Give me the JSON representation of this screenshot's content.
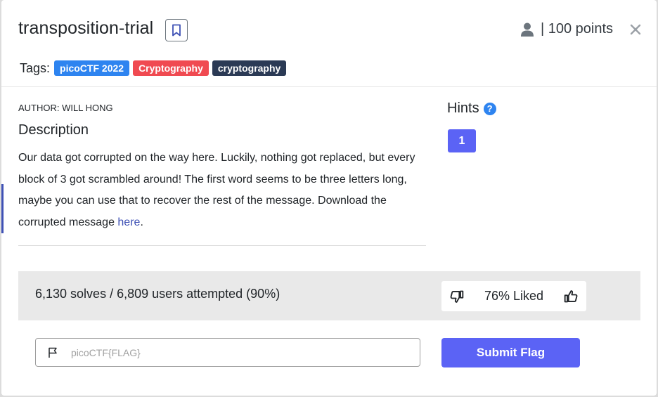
{
  "challenge": {
    "title": "transposition-trial",
    "points_label": "| 100 points"
  },
  "tags": {
    "label": "Tags:",
    "items": [
      {
        "label": "picoCTF 2022",
        "color": "#2e84f0"
      },
      {
        "label": "Cryptography",
        "color": "#f04a51"
      },
      {
        "label": "cryptography",
        "color": "#2b3a55"
      }
    ]
  },
  "description": {
    "author": "AUTHOR: WILL HONG",
    "heading": "Description",
    "body": "Our data got corrupted on the way here. Luckily, nothing got replaced, but every block of 3 got scrambled around! The first word seems to be three letters long, maybe you can use that to recover the rest of the message. Download the corrupted message ",
    "link_text": "here",
    "after_link": "."
  },
  "hints": {
    "heading": "Hints",
    "help_glyph": "?",
    "items": [
      "1"
    ]
  },
  "stats": {
    "solves_text": "6,130 solves / 6,809 users attempted (90%)",
    "liked_text": "76% Liked"
  },
  "flag": {
    "placeholder": "picoCTF{FLAG}",
    "value": "",
    "submit_label": "Submit Flag"
  },
  "icons": {
    "bookmark": "bookmark-icon",
    "person": "person-icon",
    "close": "close-icon",
    "help": "help-icon",
    "thumbs_down": "thumbs-down-icon",
    "thumbs_up": "thumbs-up-icon",
    "flag": "flag-icon"
  },
  "colors": {
    "accent": "#5b63f5",
    "link": "#3f51b5"
  }
}
